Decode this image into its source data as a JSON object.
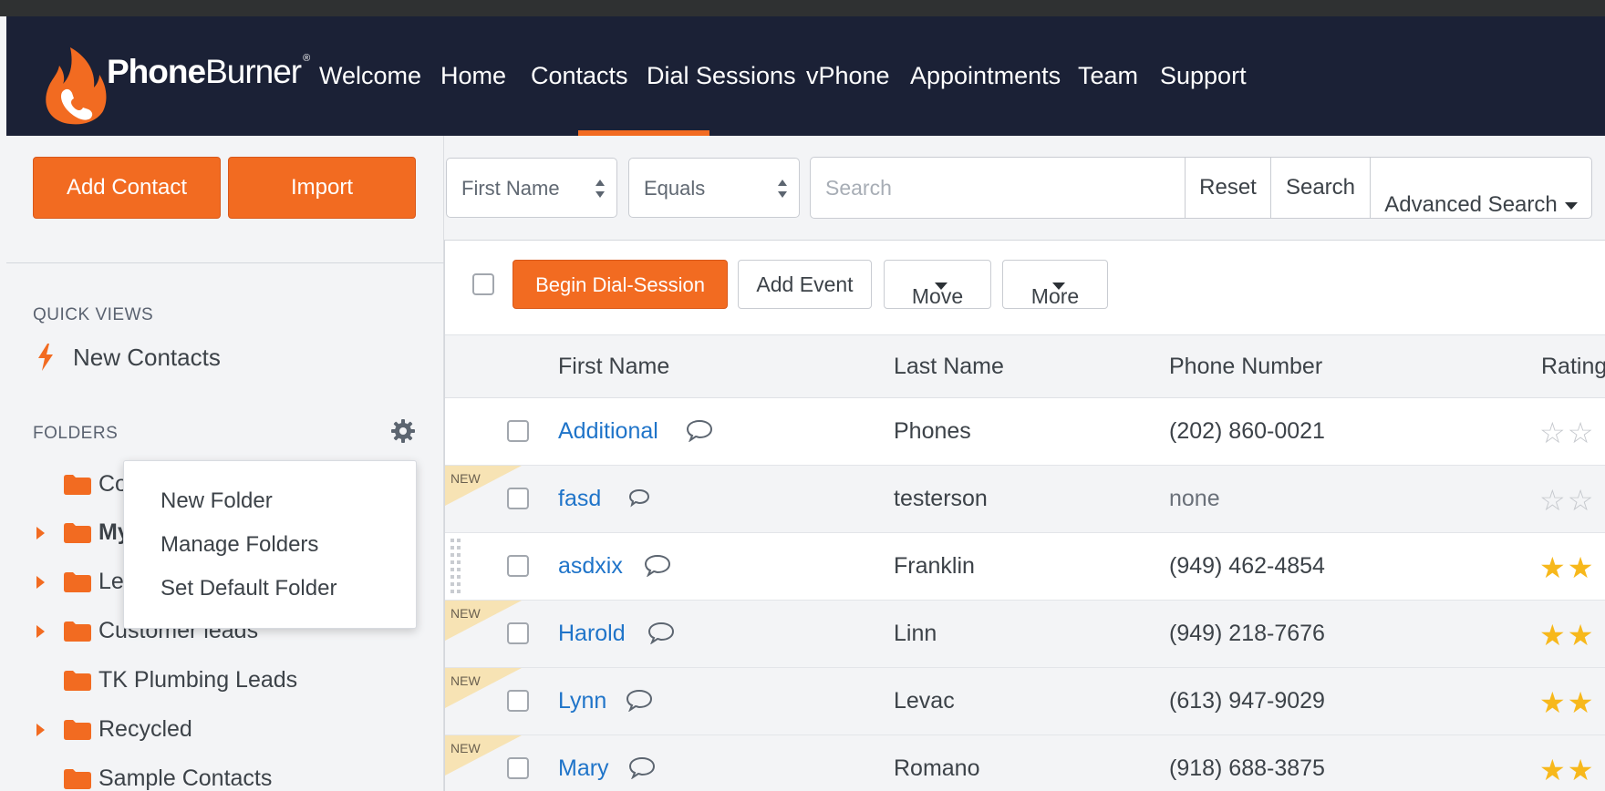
{
  "brand": {
    "name_bold": "Phone",
    "name_light": "Burner",
    "registered": "®",
    "accent": "#f26b21",
    "nav_bg": "#1b2136"
  },
  "nav": {
    "items": [
      "Welcome",
      "Home",
      "Contacts",
      "Dial Sessions",
      "vPhone",
      "Appointments",
      "Team",
      "Support"
    ],
    "active": "Contacts"
  },
  "sidebar": {
    "add_contact": "Add Contact",
    "import": "Import",
    "quick_views_title": "QUICK VIEWS",
    "new_contacts": "New Contacts",
    "folders_title": "FOLDERS",
    "folders": [
      {
        "label": "Co",
        "caret": false
      },
      {
        "label": "My",
        "caret": true,
        "bold": true
      },
      {
        "label": "Le",
        "caret": true
      },
      {
        "label": "Customer leads",
        "caret": true
      },
      {
        "label": "TK Plumbing Leads",
        "caret": false
      },
      {
        "label": "Recycled",
        "caret": true
      },
      {
        "label": "Sample Contacts",
        "caret": false
      }
    ],
    "folder_menu": [
      "New Folder",
      "Manage Folders",
      "Set Default Folder"
    ]
  },
  "search": {
    "field": "First Name",
    "operator": "Equals",
    "placeholder": "Search",
    "reset": "Reset",
    "search": "Search",
    "advanced": "Advanced Search"
  },
  "toolbar": {
    "begin_dial": "Begin Dial-Session",
    "add_event": "Add Event",
    "move": "Move",
    "more": "More"
  },
  "table": {
    "columns": [
      "First Name",
      "Last Name",
      "Phone Number",
      "Rating"
    ],
    "rows": [
      {
        "first": "Additional",
        "last": "Phones",
        "phone": "(202) 860-0021",
        "new": false,
        "stars": 0
      },
      {
        "first": "fasd",
        "last": "testerson",
        "phone": "none",
        "new": true,
        "stars": 0
      },
      {
        "first": "asdxix",
        "last": "Franklin",
        "phone": "(949) 462-4854",
        "new": false,
        "stars": 2
      },
      {
        "first": "Harold",
        "last": "Linn",
        "phone": "(949) 218-7676",
        "new": true,
        "stars": 2
      },
      {
        "first": "Lynn",
        "last": "Levac",
        "phone": "(613) 947-9029",
        "new": true,
        "stars": 2
      },
      {
        "first": "Mary",
        "last": "Romano",
        "phone": "(918) 688-3875",
        "new": true,
        "stars": 2
      }
    ],
    "new_label": "NEW",
    "star_glyph_full": "★",
    "star_glyph_empty": "☆"
  }
}
